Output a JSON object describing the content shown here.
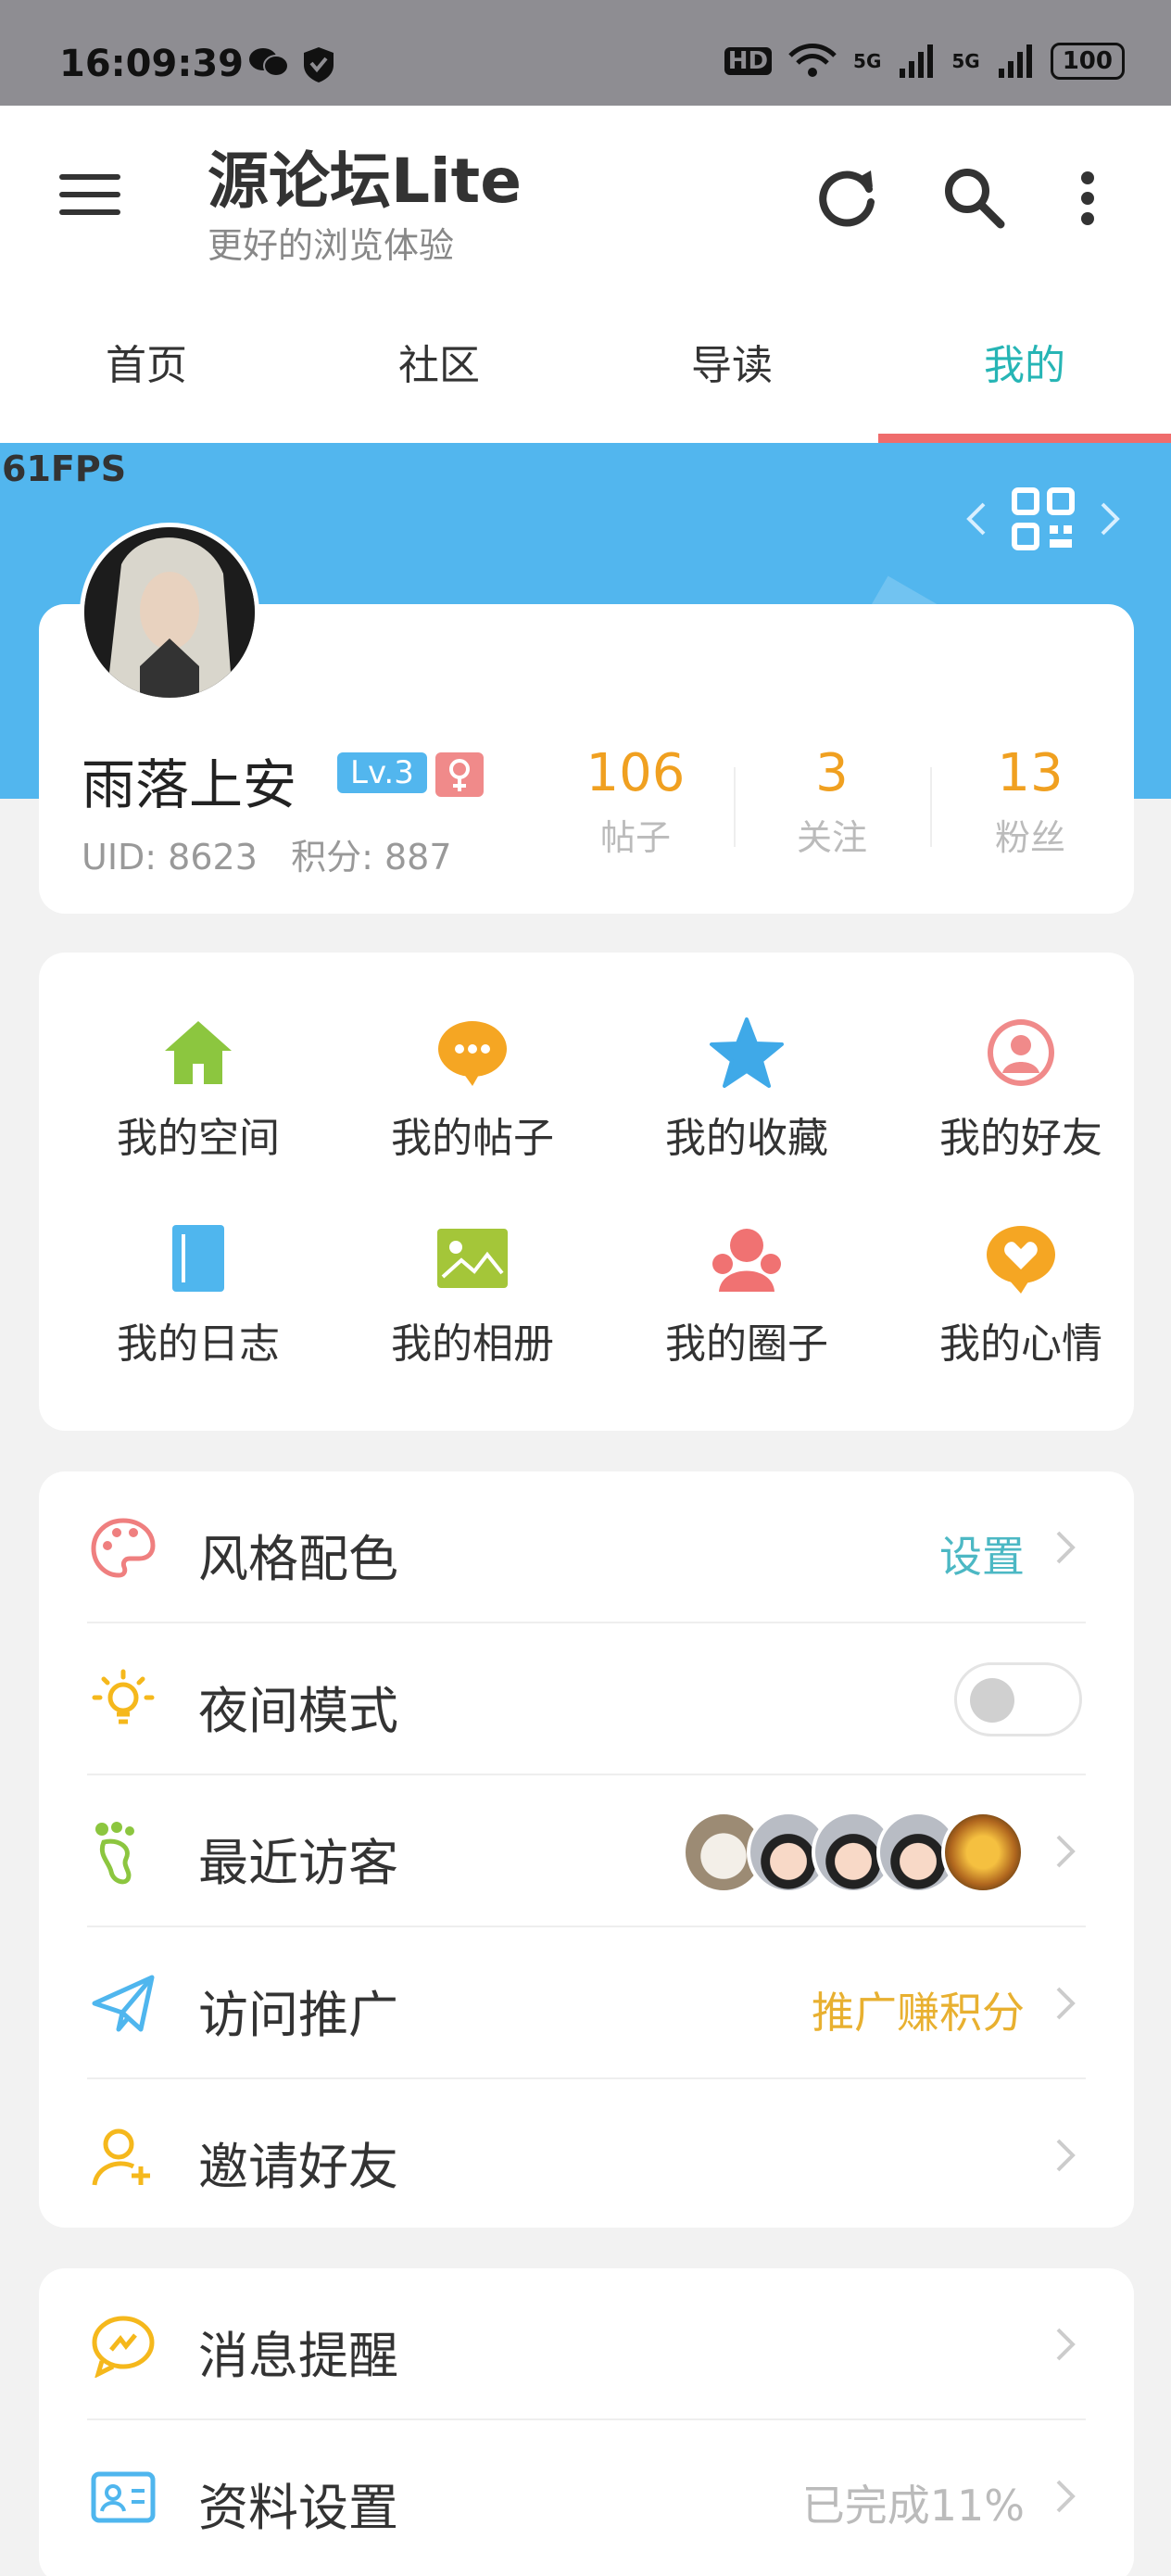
{
  "status_bar": {
    "time": "16:09:39",
    "battery": "100",
    "hd": "HD",
    "net1": "5G",
    "net2": "5G"
  },
  "app": {
    "title": "源论坛Lite",
    "subtitle": "更好的浏览体验"
  },
  "tabs": [
    {
      "label": "首页"
    },
    {
      "label": "社区"
    },
    {
      "label": "导读"
    },
    {
      "label": "我的"
    }
  ],
  "fps": "61FPS",
  "profile": {
    "name": "雨落上安",
    "level": "Lv.3",
    "uid": "UID: 8623",
    "points": "积分: 887",
    "stats": [
      {
        "value": "106",
        "label": "帖子"
      },
      {
        "value": "3",
        "label": "关注"
      },
      {
        "value": "13",
        "label": "粉丝"
      }
    ]
  },
  "grid": [
    {
      "label": "我的空间",
      "icon": "home-icon"
    },
    {
      "label": "我的帖子",
      "icon": "chat-bubble-icon"
    },
    {
      "label": "我的收藏",
      "icon": "star-icon"
    },
    {
      "label": "我的好友",
      "icon": "friend-icon"
    },
    {
      "label": "我的日志",
      "icon": "book-icon"
    },
    {
      "label": "我的相册",
      "icon": "picture-icon"
    },
    {
      "label": "我的圈子",
      "icon": "group-icon"
    },
    {
      "label": "我的心情",
      "icon": "heart-bubble-icon"
    }
  ],
  "settings": [
    {
      "label": "风格配色",
      "value": "设置",
      "value_color": "#4cb8c4"
    },
    {
      "label": "夜间模式",
      "value": ""
    },
    {
      "label": "最近访客",
      "value": ""
    },
    {
      "label": "访问推广",
      "value": "推广赚积分",
      "value_color": "#e8b030"
    },
    {
      "label": "邀请好友",
      "value": ""
    }
  ],
  "settings2": [
    {
      "label": "消息提醒",
      "value": ""
    },
    {
      "label": "资料设置",
      "value": "已完成11%",
      "value_color": "#bbbbbb"
    }
  ],
  "colors": {
    "accent_teal": "#26b5b5",
    "header_blue": "#52b6ee",
    "stat_orange": "#f0a020",
    "tab_indicator": "#ef6c6c"
  }
}
